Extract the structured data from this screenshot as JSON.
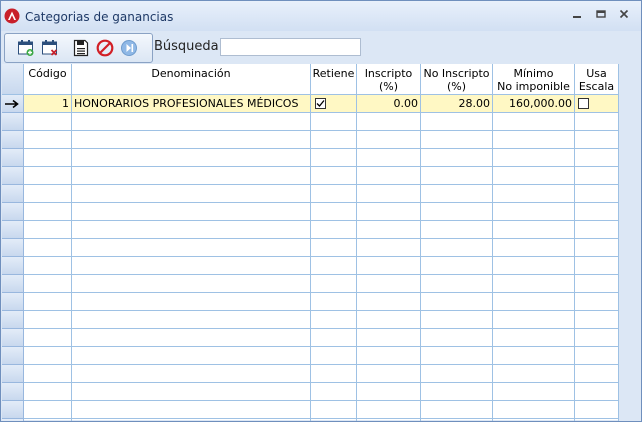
{
  "window": {
    "title": "Categorias de ganancias"
  },
  "toolbar": {
    "buttons": [
      "new-record-icon",
      "delete-record-icon",
      "save-icon",
      "cancel-icon",
      "next-icon"
    ]
  },
  "search": {
    "label": "Búsqueda",
    "value": ""
  },
  "table": {
    "headers": {
      "codigo": "Código",
      "denominacion": "Denominación",
      "retiene": "Retiene",
      "inscripto_1": "Inscripto",
      "inscripto_2": "(%)",
      "no_inscripto_1": "No Inscripto",
      "no_inscripto_2": "(%)",
      "minimo_1": "Mínimo",
      "minimo_2": "No imponible",
      "usa_1": "Usa",
      "usa_2": "Escala"
    },
    "rows": [
      {
        "codigo": "1",
        "denominacion": "HONORARIOS PROFESIONALES MÉDICOS",
        "retiene": true,
        "inscripto": "0.00",
        "no_inscripto": "28.00",
        "minimo": "160,000.00",
        "usa_escala": false
      }
    ],
    "current_row_indicator": "→"
  },
  "colors": {
    "selected_row": "#fff8c4",
    "grid_line": "#9ec1e4",
    "accent": "#1e3966"
  }
}
